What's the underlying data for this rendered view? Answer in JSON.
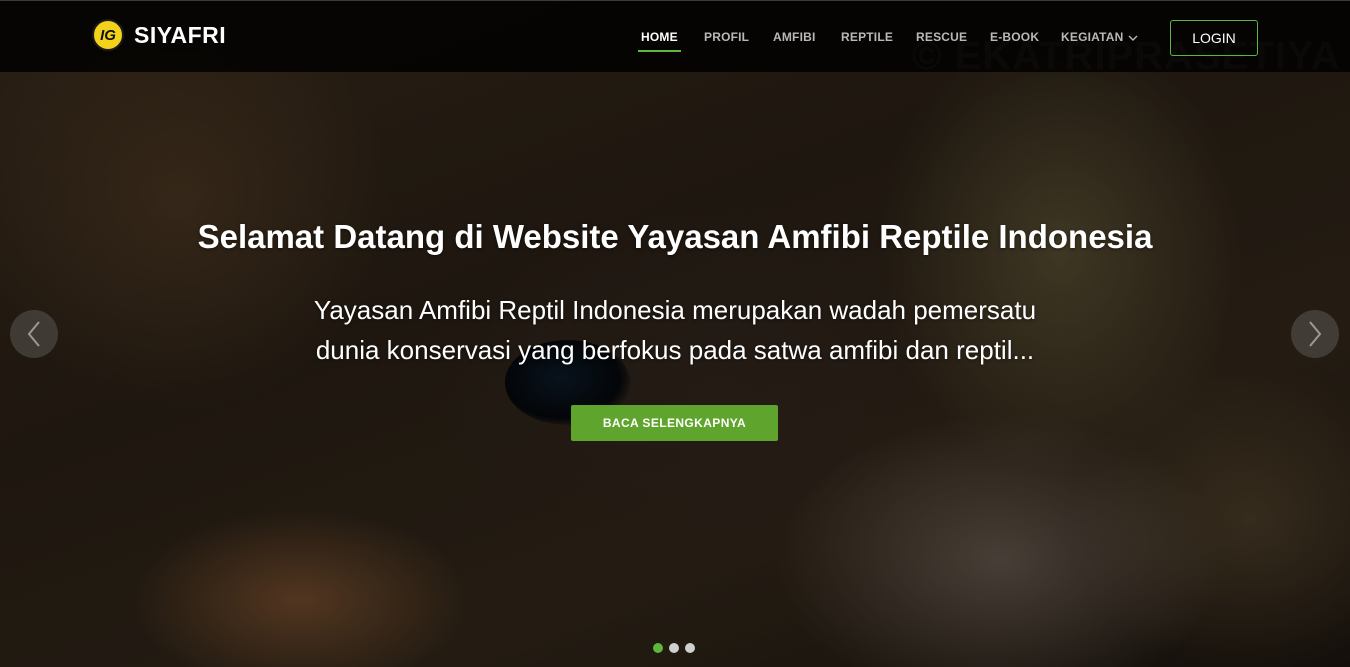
{
  "brand": {
    "name": "SIYAFRI",
    "logo_icon": "siyafri-logo-icon"
  },
  "watermark": "© EKATRIPRASETIYA",
  "nav": {
    "items": [
      {
        "label": "HOME",
        "active": true
      },
      {
        "label": "PROFIL",
        "active": false
      },
      {
        "label": "AMFIBI",
        "active": false
      },
      {
        "label": "REPTILE",
        "active": false
      },
      {
        "label": "RESCUE",
        "active": false
      },
      {
        "label": "E-BOOK",
        "active": false
      },
      {
        "label": "KEGIATAN",
        "active": false,
        "dropdown_icon": "chevron-down-icon"
      }
    ],
    "login_label": "LOGIN"
  },
  "hero": {
    "title": "Selamat Datang di Website Yayasan Amfibi Reptile Indonesia",
    "subtitle_line1": "Yayasan Amfibi Reptil Indonesia merupakan wadah pemersatu",
    "subtitle_line2": "dunia konservasi yang berfokus pada satwa amfibi dan reptil...",
    "cta_label": "BACA SELENGKAPNYA",
    "slides_count": 3,
    "active_slide": 1
  },
  "colors": {
    "accent": "#5fb63c",
    "cta": "#5fa42c",
    "navbar": "#000000"
  }
}
